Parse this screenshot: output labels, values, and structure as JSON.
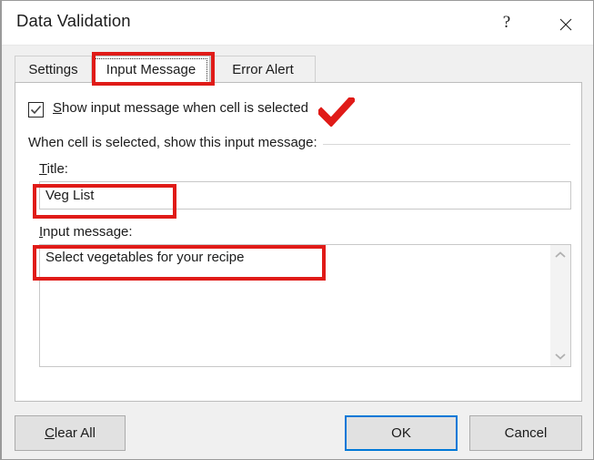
{
  "dialog": {
    "title": "Data Validation",
    "help_icon": "question-mark-icon",
    "close_icon": "close-icon",
    "accent_color": "#0078d7",
    "annotation_color": "#e01b18"
  },
  "tabs": [
    {
      "label": "Settings",
      "selected": false
    },
    {
      "label": "Input Message",
      "selected": true
    },
    {
      "label": "Error Alert",
      "selected": false
    }
  ],
  "panel": {
    "checkbox": {
      "label_prefix": "",
      "label_accel": "S",
      "label_rest": "how input message when cell is selected",
      "checked": true,
      "icon": "checkmark-icon"
    },
    "group_label": "When cell is selected, show this input message:",
    "title_field": {
      "accel": "T",
      "label_rest": "itle:",
      "value": "Veg List",
      "placeholder": ""
    },
    "message_field": {
      "accel": "I",
      "label_rest": "nput message:",
      "value": "Select vegetables for your recipe",
      "placeholder": ""
    },
    "scrollbar": {
      "up_icon": "chevron-up-icon",
      "down_icon": "chevron-down-icon"
    }
  },
  "footer": {
    "clear_all": {
      "accel": "C",
      "label_rest": "lear All"
    },
    "ok": {
      "label": "OK"
    },
    "cancel": {
      "label": "Cancel"
    }
  }
}
